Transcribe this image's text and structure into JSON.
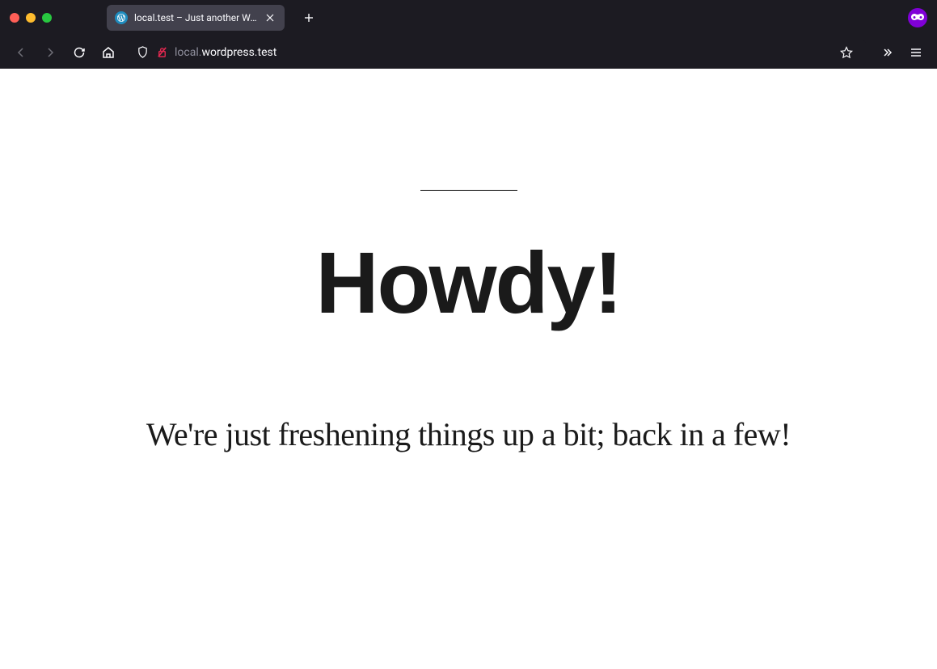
{
  "browser": {
    "tab": {
      "title": "local.test – Just another WordP",
      "favicon": "wordpress-icon"
    },
    "url": {
      "prefix": "local.",
      "domain": "wordpress.test",
      "suffix": ""
    }
  },
  "page": {
    "heading": "Howdy!",
    "subheading": "We're just freshening things up a bit; back in a few!"
  }
}
